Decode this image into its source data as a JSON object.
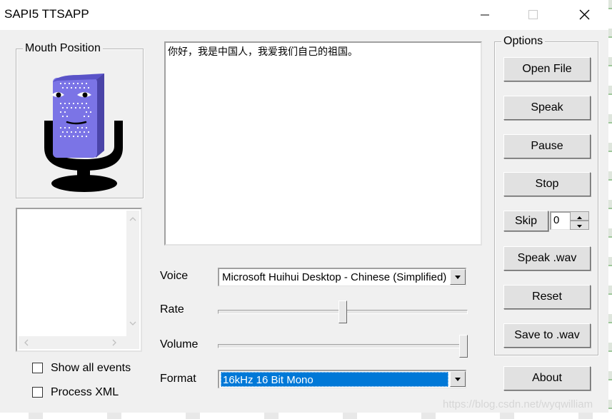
{
  "window": {
    "title": "SAPI5 TTSAPP",
    "controls": [
      "minimize-icon",
      "maximize-icon",
      "close-icon"
    ]
  },
  "mouth_group": {
    "legend": "Mouth Position"
  },
  "text_input": {
    "value": "你好，我是中国人，我爱我们自己的祖国。"
  },
  "options_group": {
    "legend": "Options"
  },
  "buttons": {
    "open_file": "Open File",
    "speak": "Speak",
    "pause": "Pause",
    "stop": "Stop",
    "skip": "Skip",
    "speak_wav": "Speak .wav",
    "reset": "Reset",
    "save_wav": "Save to .wav",
    "about": "About"
  },
  "skip_count": "0",
  "voice": {
    "label": "Voice",
    "value": "Microsoft Huihui Desktop - Chinese (Simplified)"
  },
  "rate": {
    "label": "Rate",
    "level": 0.5
  },
  "volume": {
    "label": "Volume",
    "level": 1.0
  },
  "format": {
    "label": "Format",
    "value": "16kHz 16 Bit Mono"
  },
  "checkboxes": {
    "show_all_events": "Show all events",
    "process_xml": "Process XML"
  },
  "watermark": "https://blog.csdn.net/wyqwilliam",
  "colors": {
    "mic_body": "#7b74e6",
    "mic_stand": "#000000",
    "selection": "#0078d7"
  }
}
